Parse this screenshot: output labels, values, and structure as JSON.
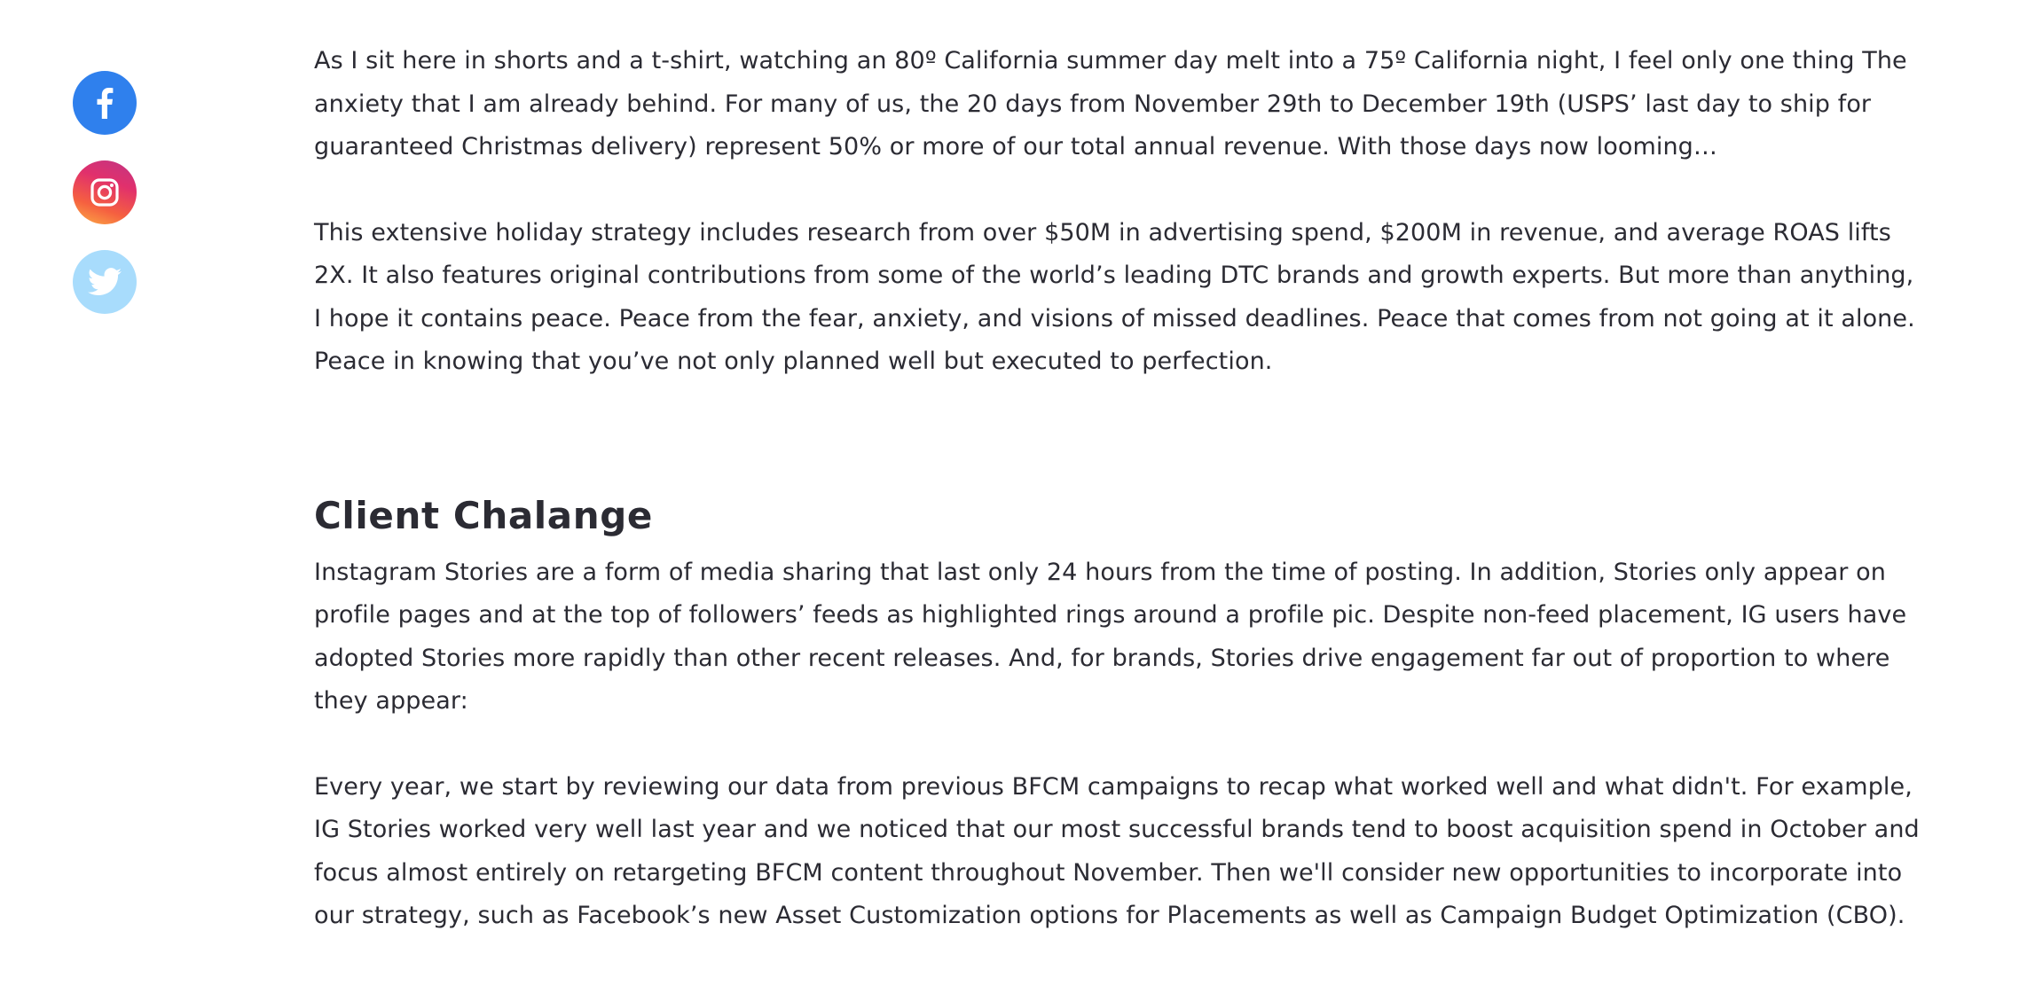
{
  "social": {
    "facebook_icon": "facebook-icon",
    "instagram_icon": "instagram-icon",
    "twitter_icon": "twitter-icon",
    "colors": {
      "facebook": "#2f80ed",
      "instagram_from": "#c13584",
      "instagram_to": "#fcaf45",
      "twitter": "#a8dcfc"
    }
  },
  "article": {
    "intro_paragraph": "As I sit here in shorts and a t-shirt, watching an 80º California summer day melt into a 75º California night, I feel only one thing The anxiety that I am already behind. For many of us, the 20 days from November 29th to December 19th (USPS’ last day to ship for guaranteed Christmas delivery) represent 50% or more of our total annual revenue. With those days now looming…",
    "strategy_paragraph": "This extensive holiday strategy includes research from over $50M in advertising spend, $200M in revenue, and average ROAS lifts 2X. It also features original contributions from some of the world’s leading DTC brands and growth experts. But more than anything, I hope it contains peace. Peace from the fear, anxiety, and visions of missed deadlines. Peace that comes from not going at it alone. Peace in knowing that you’ve not only planned well but executed to perfection.",
    "section_heading": "Client Chalange",
    "stories_paragraph": "Instagram Stories are a form of media sharing that last only 24 hours from the time of posting. In addition, Stories only appear on profile pages and at the top of followers’ feeds as highlighted rings around a profile pic. Despite non-feed placement, IG users have adopted Stories more rapidly than other recent releases. And, for brands, Stories drive engagement far out of proportion to where they appear:",
    "review_paragraph": "Every year, we start by reviewing our data from previous BFCM campaigns to recap what worked well and what didn't. For example, IG Stories worked very well last year and we noticed that our most successful brands tend to boost acquisition spend in October and focus almost entirely on retargeting BFCM content throughout November. Then we'll consider new opportunities to incorporate into our strategy, such as Facebook’s new Asset Customization options for Placements as well as Campaign Budget Optimization (CBO)."
  }
}
